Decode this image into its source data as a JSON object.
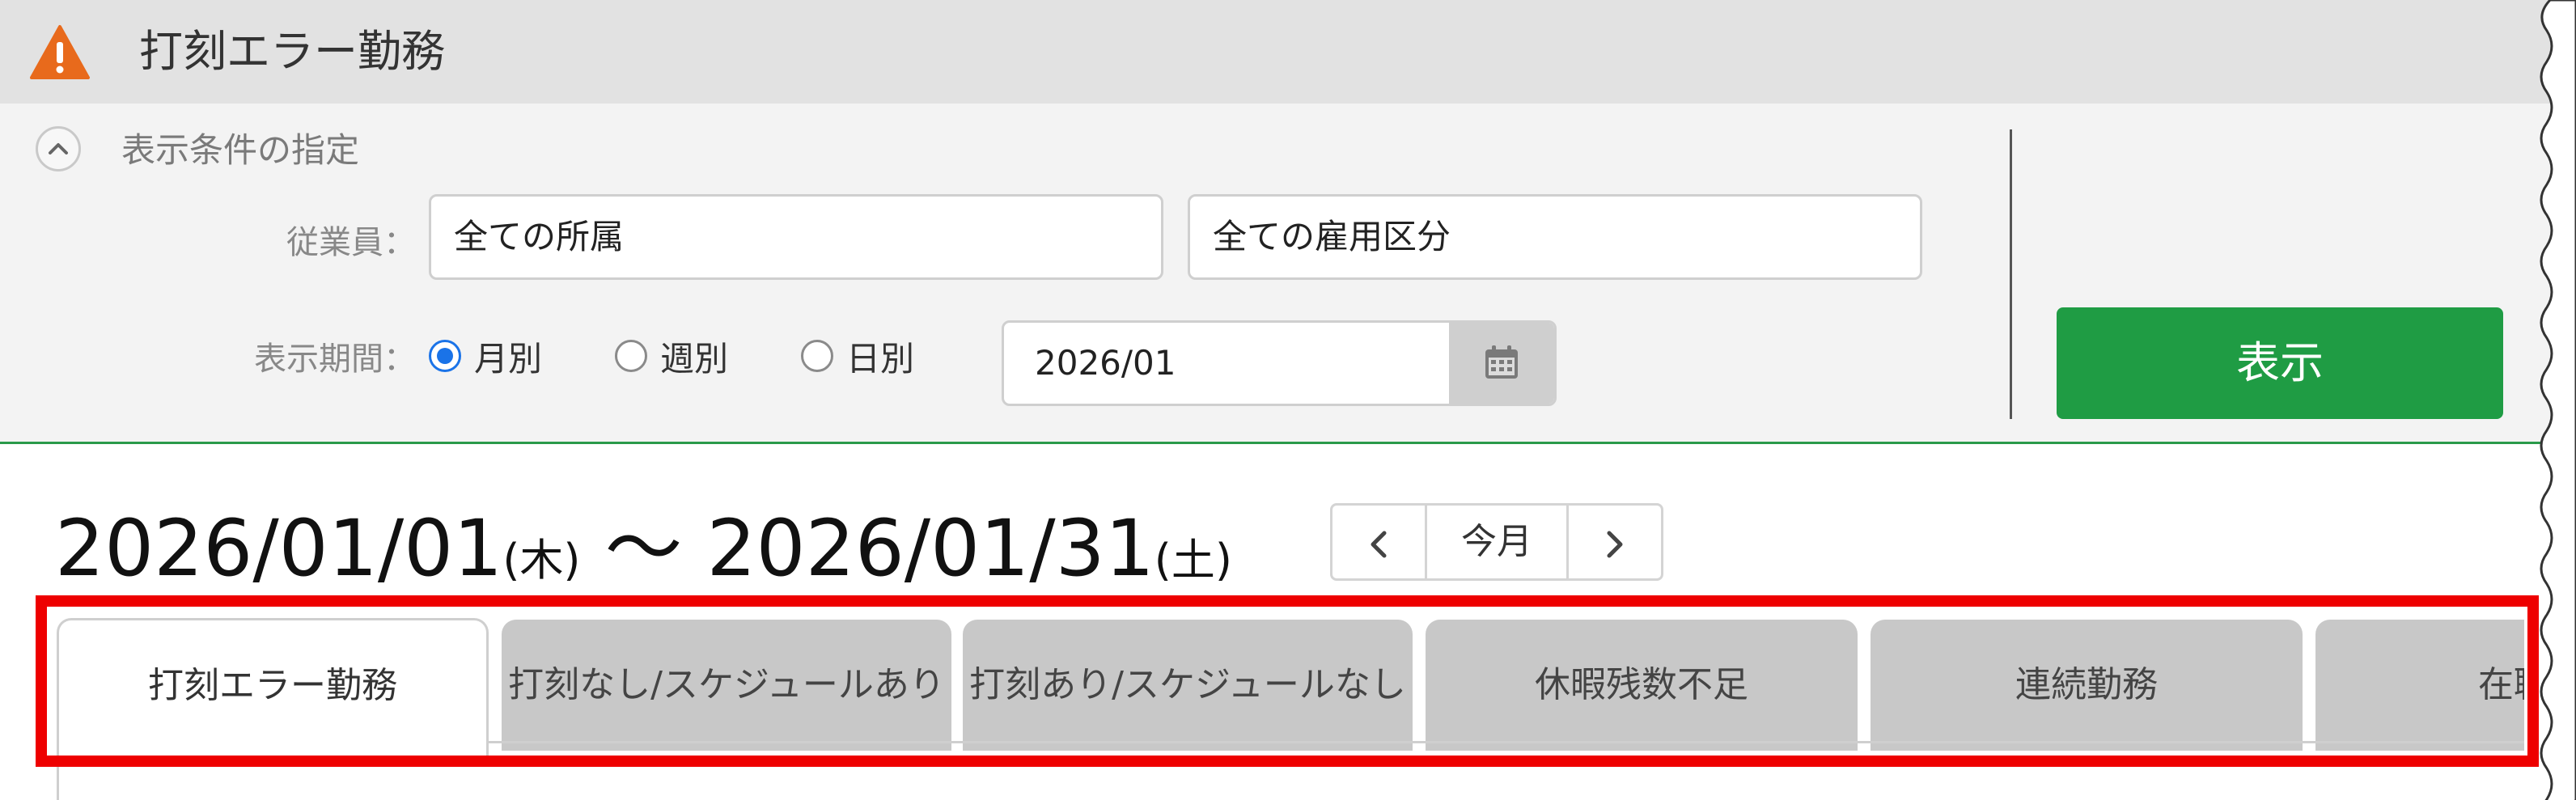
{
  "header": {
    "title": "打刻エラー勤務",
    "icon": "warning-icon"
  },
  "conditions": {
    "toggle_label": "表示条件の指定",
    "employee_label": "従業員：",
    "department_value": "全ての所属",
    "employment_type_value": "全ての雇用区分",
    "period_label": "表示期間：",
    "period_options": [
      {
        "label": "月別",
        "selected": true
      },
      {
        "label": "週別",
        "selected": false
      },
      {
        "label": "日別",
        "selected": false
      }
    ],
    "date_value": "2026/01",
    "show_button": "表示"
  },
  "range": {
    "start_date": "2026/01/01",
    "start_day": "(木)",
    "separator": "〜",
    "end_date": "2026/01/31",
    "end_day": "(土)"
  },
  "pager": {
    "today_label": "今月"
  },
  "tabs": [
    {
      "label": "打刻エラー勤務",
      "active": true
    },
    {
      "label": "打刻なし/スケジュールあり",
      "active": false
    },
    {
      "label": "打刻あり/スケジュールなし",
      "active": false
    },
    {
      "label": "休暇残数不足",
      "active": false
    },
    {
      "label": "連続勤務",
      "active": false
    },
    {
      "label": "在職外",
      "active": false
    }
  ],
  "colors": {
    "accent_green": "#1f9c44",
    "radio_blue": "#1a73e8",
    "warning_orange": "#e86a1c",
    "highlight_red": "#ee0000"
  }
}
